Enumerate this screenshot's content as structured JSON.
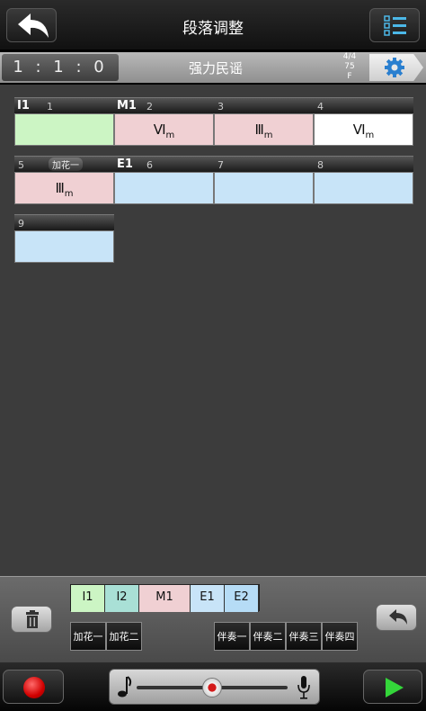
{
  "header": {
    "title": "段落调整"
  },
  "info": {
    "position": "1 : 1 : 0",
    "song": "强力民谣",
    "time_sig": "4/4",
    "tempo": "75",
    "key": "F"
  },
  "colors": {
    "intro": "#ccf5c4",
    "main": "#f0d0d3",
    "ending": "#c8e4f8",
    "empty": "#ffffff",
    "interlude": "#a9e0d6",
    "ending2": "#b6dcf6"
  },
  "grid": {
    "cells": [
      {
        "num": "1",
        "tag": "I1",
        "fill": "",
        "chord": "",
        "sub": "",
        "color": "intro"
      },
      {
        "num": "2",
        "tag": "M1",
        "fill": "",
        "chord": "Ⅵ",
        "sub": "m",
        "color": "main"
      },
      {
        "num": "3",
        "tag": "",
        "fill": "",
        "chord": "Ⅲ",
        "sub": "m",
        "color": "main"
      },
      {
        "num": "4",
        "tag": "",
        "fill": "",
        "chord": "Ⅵ",
        "sub": "m",
        "color": "empty"
      },
      {
        "num": "5",
        "tag": "",
        "fill": "加花一",
        "chord": "Ⅲ",
        "sub": "m",
        "color": "main"
      },
      {
        "num": "6",
        "tag": "E1",
        "fill": "",
        "chord": "",
        "sub": "",
        "color": "ending"
      },
      {
        "num": "7",
        "tag": "",
        "fill": "",
        "chord": "",
        "sub": "",
        "color": "ending"
      },
      {
        "num": "8",
        "tag": "",
        "fill": "",
        "chord": "",
        "sub": "",
        "color": "ending"
      },
      {
        "num": "9",
        "tag": "",
        "fill": "",
        "chord": "",
        "sub": "",
        "color": "ending"
      }
    ]
  },
  "legend": [
    {
      "label": "I1",
      "color": "#ccf5c4"
    },
    {
      "label": "I2",
      "color": "#a9e0d6"
    },
    {
      "label": "M1",
      "color": "#f0d0d3"
    },
    {
      "label": "E1",
      "color": "#c8e4f8"
    },
    {
      "label": "E2",
      "color": "#b6dcf6"
    }
  ],
  "fills": [
    "加花一",
    "加花二"
  ],
  "accompaniments": [
    "伴奏一",
    "伴奏二",
    "伴奏三",
    "伴奏四"
  ],
  "icons": {
    "back": "back-arrow-icon",
    "list": "list-icon",
    "settings": "gear-icon",
    "trash": "trash-icon",
    "undo": "undo-icon",
    "record": "record-icon",
    "play": "play-icon",
    "note": "music-note-icon",
    "mic": "microphone-icon"
  },
  "slider": {
    "level": 0.5
  }
}
